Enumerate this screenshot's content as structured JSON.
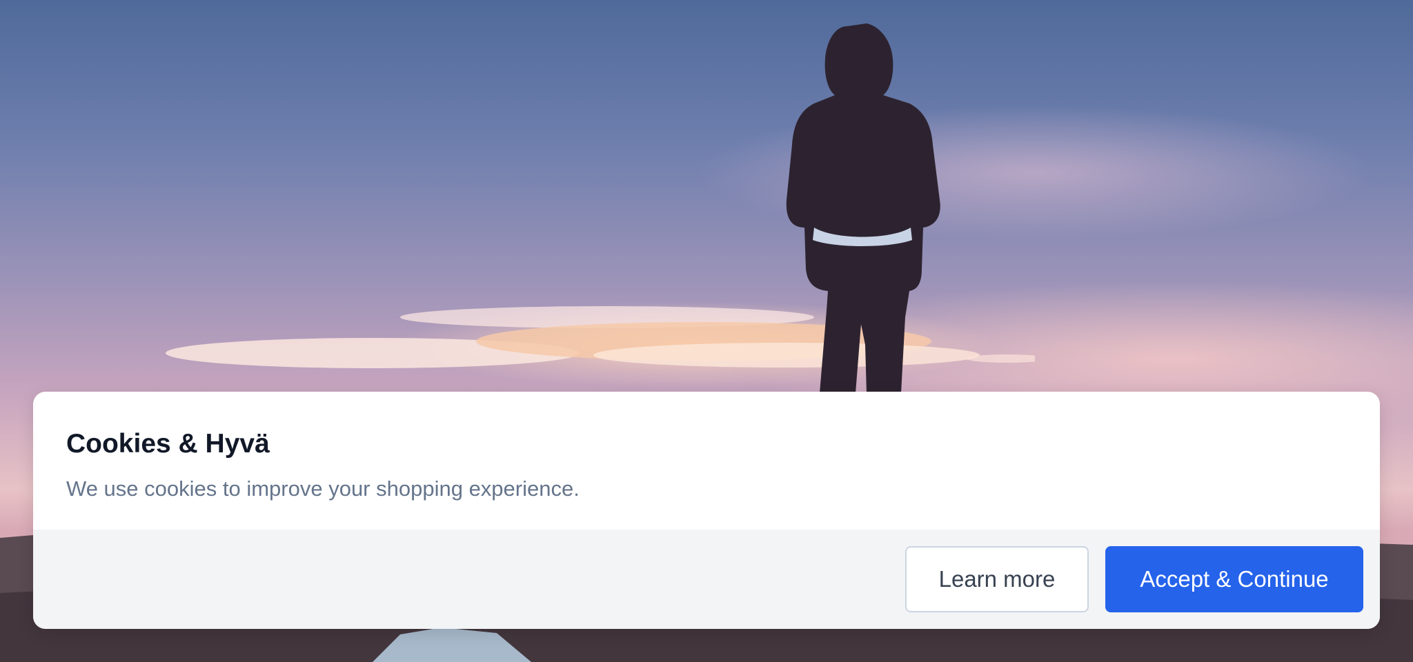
{
  "cookie_banner": {
    "title": "Cookies & Hyvä",
    "message": "We use cookies to improve your shopping experience.",
    "learn_more_label": "Learn more",
    "accept_label": "Accept & Continue"
  },
  "colors": {
    "primary_button": "#2563eb",
    "title_text": "#111827",
    "body_text": "#64748b",
    "footer_background": "#f3f4f6"
  }
}
